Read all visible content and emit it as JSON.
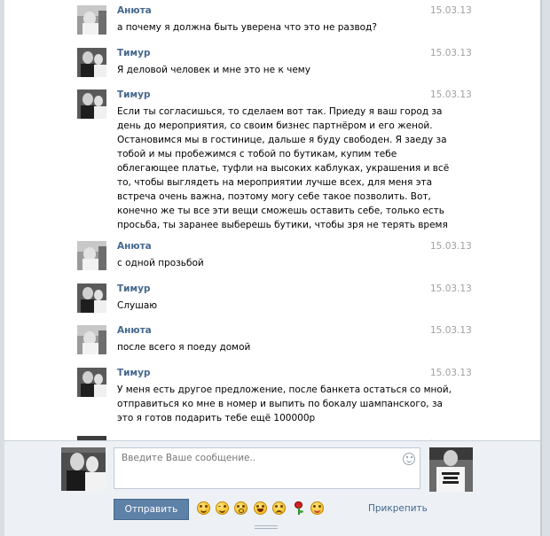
{
  "messages": [
    {
      "author": "Анюта",
      "date": "15.03.13",
      "lines": [
        "а почему я должна быть уверена что это не развод?"
      ]
    },
    {
      "author": "Тимур",
      "date": "15.03.13",
      "lines": [
        "Я деловой человек и мне это не к чему"
      ]
    },
    {
      "author": "Тимур",
      "date": "15.03.13",
      "lines": [
        "Если ты согласишься, то сделаем вот так. Приеду я ваш город за",
        "день до мероприятия, со своим бизнес партнёром и его женой.",
        "Остановимся мы в гостинице, дальше я буду свободен. Я заеду за",
        "тобой и мы пробежимся с тобой по бутикам, купим тебе",
        "облегающее платье, туфли на высоких каблуках, украшения и всё",
        "то, чтобы выглядеть на мероприятии лучше всех, для меня эта",
        "встреча очень важна, поэтому могу себе такое позволить. Вот,",
        "конечно же ты все эти вещи сможешь оставить себе, только есть",
        "просьба, ты заранее выберешь бутики, чтобы зря не терять время"
      ]
    },
    {
      "author": "Анюта",
      "date": "15.03.13",
      "lines": [
        "с одной прозьбой"
      ]
    },
    {
      "author": "Тимур",
      "date": "15.03.13",
      "lines": [
        "Слушаю"
      ]
    },
    {
      "author": "Анюта",
      "date": "15.03.13",
      "lines": [
        "после всего я поеду домой"
      ]
    },
    {
      "author": "Тимур",
      "date": "15.03.13",
      "lines": [
        "У меня есть другое предложение, после банкета остаться со мной,",
        "отправиться ко мне в номер и выпить по бокалу шампанского, за",
        "это я готов подарить тебе ещё 100000р"
      ]
    }
  ],
  "composer": {
    "placeholder": "Введите Ваше сообщение..",
    "send_label": "Отправить",
    "attach_label": "Прикрепить",
    "emoji_icons": [
      "smile-icon",
      "wink-icon",
      "scared-icon",
      "grin-icon",
      "crying-icon",
      "rose-icon",
      "tongue-icon"
    ],
    "smile_toggle_icon": "smiley-outline-icon"
  },
  "colors": {
    "author": "#45688e",
    "date": "#a0a0a0",
    "button": "#5e81a8",
    "composer_bg": "#edf1f5"
  }
}
